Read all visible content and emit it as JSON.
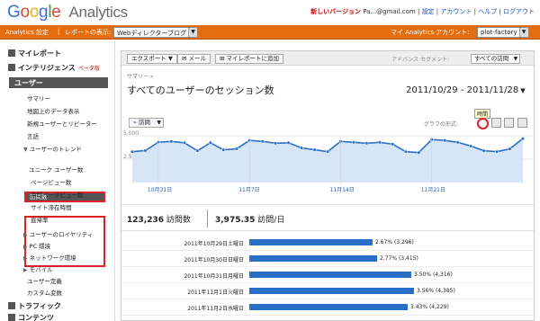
{
  "header": {
    "logo_google": "Google",
    "logo_product": "Analytics",
    "new_version": "新しいバージョン",
    "email": "Pa...@gmail.com",
    "settings": "設定",
    "account": "アカウント",
    "help": "ヘルプ",
    "logout": "ログアウト"
  },
  "orangebar": {
    "settings": "Analytics 設定",
    "report_view": "レポートの表示:",
    "profile": "Webディレクターブログ",
    "my_account": "マイ Analytics アカウント:",
    "account_name": "plot-factory"
  },
  "sidebar": {
    "my_report": "マイレポート",
    "intelligence": "インテリジェンス",
    "intelligence_badge": "ベータ版",
    "users": "ユーザー",
    "items": [
      "サマリー",
      "地図上のデータ表示",
      "新規ユーザーとリピーター",
      "言語",
      "ユーザーのトレンド",
      "訪問数",
      "ユニーク ユーザー数",
      "ページビュー数",
      "平均ページビュー数",
      "サイト滞在時間",
      "直帰率",
      "ユーザーのロイヤリティ",
      "PC 環境",
      "ネットワーク環境",
      "モバイル",
      "ユーザー定義",
      "カスタム変数"
    ],
    "traffic": "トラフィック",
    "content": "コンテンツ"
  },
  "toolbar": {
    "export": "エクスポート",
    "email": "メール",
    "add_report": "マイレポートに追加",
    "segment_label": "アドバンス セグメント:",
    "segment_value": "すべての訪問"
  },
  "page": {
    "crumb": "サマリー »",
    "title": "すべてのユーザーのセッション数",
    "date_range": "2011/10/29 - 2011/11/28"
  },
  "chart_controls": {
    "metric": "訪問",
    "graph_format": "グラフの形式:",
    "time_label": "時間"
  },
  "chart_data": {
    "type": "area",
    "title": "",
    "xlabel": "",
    "ylabel": "",
    "ylim": [
      0,
      5000
    ],
    "y_ticks": [
      "5,000",
      "2,500"
    ],
    "x_ticks": [
      "10月31日",
      "11月7日",
      "11月14日",
      "11月21日"
    ],
    "x": [
      "2011-10-29",
      "2011-10-30",
      "2011-10-31",
      "2011-11-01",
      "2011-11-02",
      "2011-11-03",
      "2011-11-04",
      "2011-11-05",
      "2011-11-06",
      "2011-11-07",
      "2011-11-08",
      "2011-11-09",
      "2011-11-10",
      "2011-11-11",
      "2011-11-12",
      "2011-11-13",
      "2011-11-14",
      "2011-11-15",
      "2011-11-16",
      "2011-11-17",
      "2011-11-18",
      "2011-11-19",
      "2011-11-20",
      "2011-11-21",
      "2011-11-22",
      "2011-11-23",
      "2011-11-24",
      "2011-11-25",
      "2011-11-26",
      "2011-11-27",
      "2011-11-28"
    ],
    "series": [
      {
        "values": [
          3296,
          3415,
          4316,
          4390,
          4250,
          3400,
          4250,
          3500,
          3600,
          4500,
          4400,
          4200,
          4250,
          3700,
          3500,
          3300,
          4400,
          4300,
          4200,
          4300,
          4100,
          3300,
          3200,
          4600,
          4500,
          4300,
          3900,
          3400,
          3300,
          3600,
          4700
        ]
      }
    ],
    "grid": true,
    "colors": {
      "line": "#2a6ec8",
      "fill": "#d6e6f6"
    }
  },
  "stats": {
    "visits": "123,236",
    "visits_label": "訪問数",
    "visits_per_day": "3,975.35",
    "visits_per_day_label": "訪問/日"
  },
  "rows": [
    {
      "date": "2011年10月29日土曜日",
      "label": "2.67% (3,296)",
      "value": 3296
    },
    {
      "date": "2011年10月30日日曜日",
      "label": "2.77% (3,415)",
      "value": 3415
    },
    {
      "date": "2011年10月31日月曜日",
      "label": "3.50% (4,316)",
      "value": 4316
    },
    {
      "date": "2011年11月1日火曜日",
      "label": "3.56% (4,385)",
      "value": 4385
    },
    {
      "date": "2011年11月2日水曜日",
      "label": "3.43% (4,229)",
      "value": 4229
    }
  ],
  "colors": {
    "orange": "#e46d10",
    "highlight_red": "#d22",
    "bar_blue": "#2a6ec8",
    "link_blue": "#1f4fb8"
  }
}
